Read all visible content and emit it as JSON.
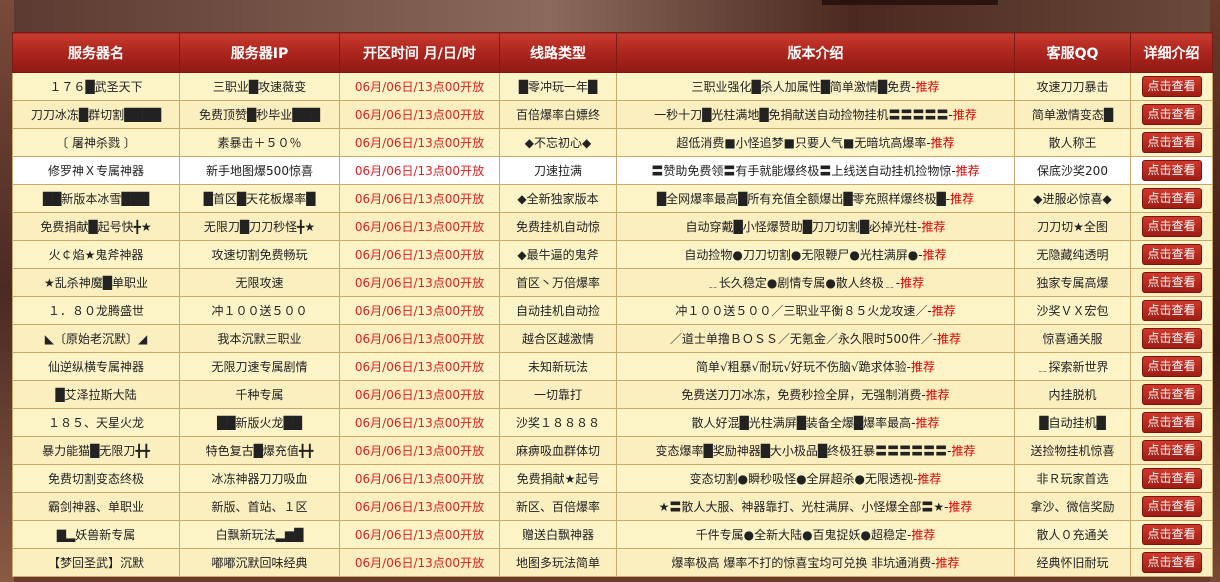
{
  "header": {
    "name": "服务器名",
    "ip": "服务器IP",
    "time": "开区时间 月/日/时",
    "line": "线路类型",
    "intro": "版本介绍",
    "qq": "客服QQ",
    "detail": "详细介绍"
  },
  "detail_label": "点击查看",
  "rows": [
    {
      "name": "１７６█武圣天下",
      "ip": "三职业█攻速薇变",
      "time": "06月/06日/13点00开放",
      "line": "█零冲玩一年█",
      "intro": "三职业强化█杀人加属性█简单激情█免费-",
      "rec": "推荐",
      "qq": "攻速刀刀暴击"
    },
    {
      "name": "刀刀冰冻█群切割████",
      "ip": "免费顶赞█秒毕业███",
      "time": "06月/06日/13点00开放",
      "line": "百倍爆率白嫖终",
      "intro": "一秒十刀█光柱满地█免捐献送自动捡物挂机〓〓〓〓〓-",
      "rec": "推荐",
      "qq": "简单激情变态█"
    },
    {
      "name": "〔 屠神杀戮 〕",
      "ip": "素暴击＋５０％",
      "time": "06月/06日/13点00开放",
      "line": "◆不忘初心◆",
      "intro": "超低消费■小怪追梦■只要人气■无暗坑高爆率-",
      "rec": "推荐",
      "qq": "散人称王"
    },
    {
      "name": "修罗神Ｘ专属神器",
      "ip": "新手地图爆500惊喜",
      "time": "06月/06日/13点00开放",
      "line": "刀速拉满",
      "intro": "〓赞助免费领〓有手就能爆终极〓上线送自动挂机捡物惊-",
      "rec": "推荐",
      "qq": "保底沙奖200",
      "hl": true
    },
    {
      "name": "██新版本冰雪███",
      "ip": "█首区█天花板爆率█",
      "time": "06月/06日/13点00开放",
      "line": "◆全新独家版本",
      "intro": "█全网爆率最高█所有充值全额爆出█零充照样爆终极█-",
      "rec": "推荐",
      "qq": "◆进服必惊喜◆"
    },
    {
      "name": "免费捐献█起号快╋★",
      "ip": "无限刀█刀刀秒怪╋★",
      "time": "06月/06日/13点00开放",
      "line": "免费挂机自动惊",
      "intro": "自动穿戴█小怪爆赞助█刀刀切割█必掉光柱-",
      "rec": "推荐",
      "qq": "刀刀切★全图"
    },
    {
      "name": "火￠焰★鬼斧神器",
      "ip": "攻速切割免费畅玩",
      "time": "06月/06日/13点00开放",
      "line": "◆最牛逼的鬼斧",
      "intro": "自动捡物●刀刀切割●无限鞭尸●光柱满屏●-",
      "rec": "推荐",
      "qq": "无隐藏纯透明"
    },
    {
      "name": "★乱杀神魔█单职业",
      "ip": "无限攻速",
      "time": "06月/06日/13点00开放",
      "line": "首区丶万倍爆率",
      "intro": "﹎长久稳定●剧情专属●散人终极﹎-",
      "rec": "推荐",
      "qq": "独家专属高爆"
    },
    {
      "name": "１．８０龙腾盛世",
      "ip": "冲１００送５００",
      "time": "06月/06日/13点00开放",
      "line": "自动挂机自动捡",
      "intro": "冲１００送５００／三职业平衡８５火龙攻速／-",
      "rec": "推荐",
      "qq": "沙奖ＶＸ宏包"
    },
    {
      "name": "◣〔原始老沉默〕◢",
      "ip": "我本沉默三职业",
      "time": "06月/06日/13点00开放",
      "line": "越合区越激情",
      "intro": "／道士单撸ＢＯＳＳ／无氪金／永久限时500件／-",
      "rec": "推荐",
      "qq": "惊喜通关服"
    },
    {
      "name": "仙逆纵横专属神器",
      "ip": "无限刀速专属剧情",
      "time": "06月/06日/13点00开放",
      "line": "未知新玩法",
      "intro": "简单√粗暴√耐玩√好玩不伤脑√跪求体验-",
      "rec": "推荐",
      "qq": "﹎探索新世界"
    },
    {
      "name": "█艾泽拉斯大陆",
      "ip": "千种专属",
      "time": "06月/06日/13点00开放",
      "line": "一切靠打",
      "intro": "免费送刀刀冰冻，免费秒捡全屏，无强制消费-",
      "rec": "推荐",
      "qq": "内挂脱机"
    },
    {
      "name": "１８５、天星火龙",
      "ip": "██新版火龙██",
      "time": "06月/06日/13点00开放",
      "line": "沙奖１８８８８",
      "intro": "散人好混█光柱满屏█装备全爆█爆率最高-",
      "rec": "推荐",
      "qq": "█自动挂机█"
    },
    {
      "name": "暴力能猫█无限刀╋╋",
      "ip": "特色复古█爆充值╋╋",
      "time": "06月/06日/13点00开放",
      "line": "麻痹吸血群体切",
      "intro": "变态爆率█奖励神器█大小极品█终极狂暴〓〓〓〓〓〓-",
      "rec": "推荐",
      "qq": "送捡物挂机惊喜"
    },
    {
      "name": "免费切割变态终极",
      "ip": "冰冻神器刀刀吸血",
      "time": "06月/06日/13点00开放",
      "line": "免费捐献★起号",
      "intro": "变态切割●瞬秒吸怪●全屏超杀●无限透视-",
      "rec": "推荐",
      "qq": "非Ｒ玩家首选"
    },
    {
      "name": "霸剑神器、单职业",
      "ip": "新版、首站、１区",
      "time": "06月/06日/13点00开放",
      "line": "新区、百倍爆率",
      "intro": "★〓散人大服、神器靠打、光柱满屏、小怪爆全部〓★-",
      "rec": "推荐",
      "qq": "拿沙、微信奖励"
    },
    {
      "name": "▇▂妖兽新专属",
      "ip": "白飘新玩法▂▆█",
      "time": "06月/06日/13点00开放",
      "line": "赠送白飘神器",
      "intro": "千件专属●全新大陆●百鬼捉妖●超稳定-",
      "rec": "推荐",
      "qq": "散人０充通关"
    },
    {
      "name": "【梦回圣武】沉默",
      "ip": "嘟嘟沉默回味经典",
      "time": "06月/06日/13点00开放",
      "line": "地图多玩法简单",
      "intro": "爆率极高 爆率不打的惊喜宝均可兑换 非坑通消费-",
      "rec": "推荐",
      "qq": "经典怀旧耐玩"
    }
  ]
}
